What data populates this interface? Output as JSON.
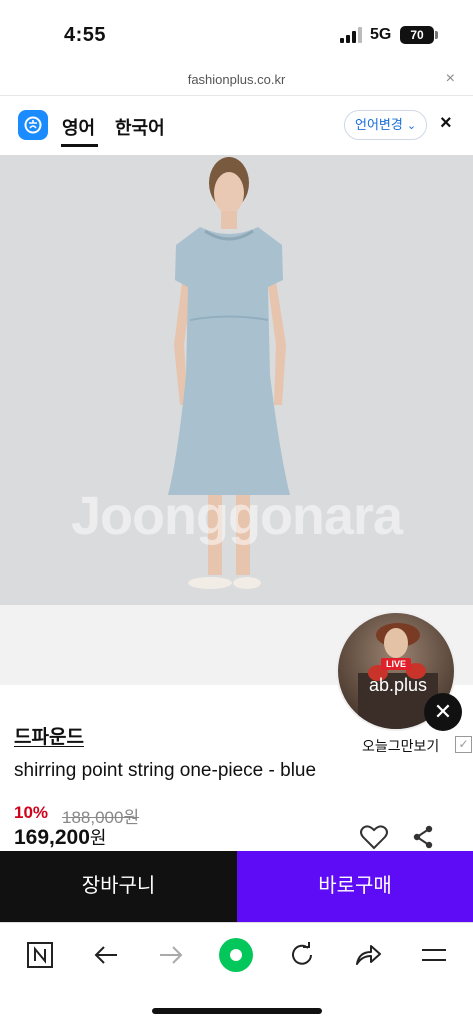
{
  "status_bar": {
    "time": "4:55",
    "network": "5G",
    "battery": "70"
  },
  "url_bar": {
    "url": "fashionplus.co.kr",
    "close_symbol": "×"
  },
  "translate_bar": {
    "tab_english": "영어",
    "tab_korean": "한국어",
    "change_language": "언어변경",
    "close_symbol": "×"
  },
  "product_image": {
    "watermark": "Joonggonara"
  },
  "live_popup": {
    "badge": "LIVE",
    "brand": "ab.plus",
    "hide_today": "오늘그만보기",
    "close_symbol": "✕",
    "check_symbol": "✓"
  },
  "product": {
    "brand": "드파운드",
    "name": "shirring point string one-piece - blue",
    "discount_rate": "10%",
    "original_price": "188,000원",
    "final_price": "169,200",
    "currency": "원"
  },
  "buttons": {
    "cart": "장바구니",
    "buy_now": "바로구매"
  },
  "colors": {
    "buy_accent": "#5d0cf5",
    "discount": "#d0021b",
    "browser_green": "#03c75a",
    "translate_blue": "#1a8cff"
  },
  "toolbar": {
    "icons": [
      "naver-n-icon",
      "back-arrow-icon",
      "forward-arrow-icon",
      "green-dot-icon",
      "reload-icon",
      "share-arrow-icon",
      "menu-icon"
    ]
  }
}
